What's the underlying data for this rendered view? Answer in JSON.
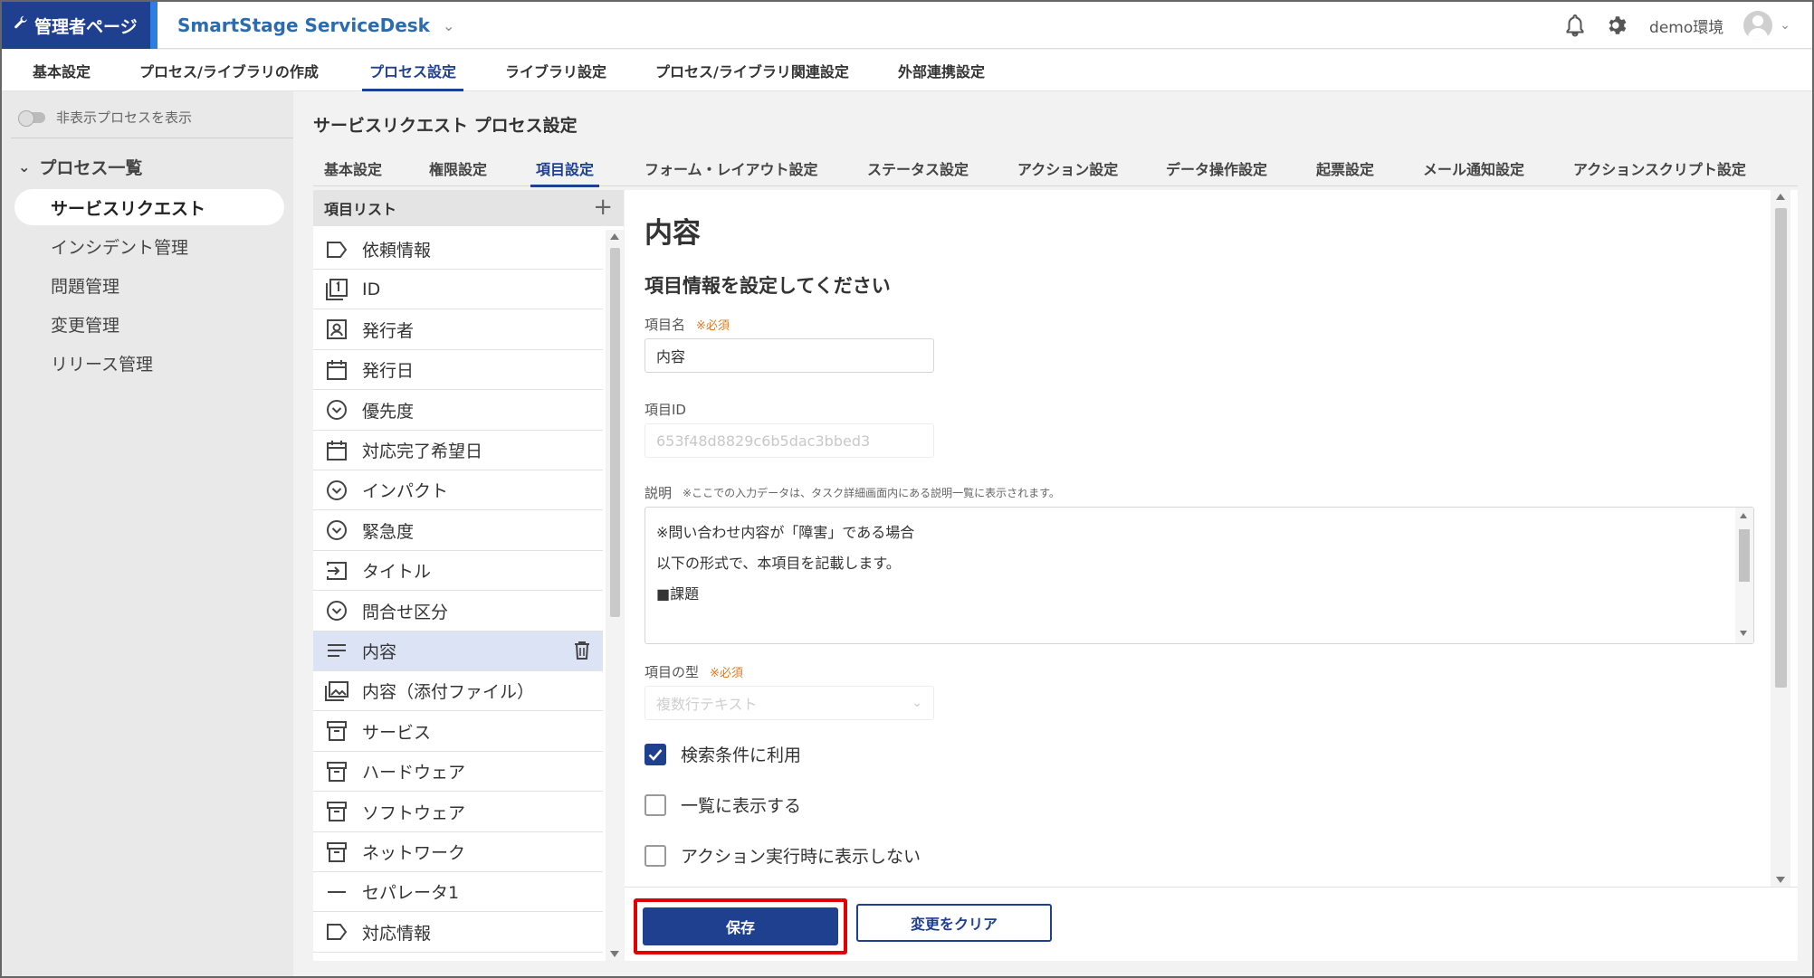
{
  "header": {
    "admin_label": "管理者ページ",
    "app_title": "SmartStage ServiceDesk",
    "environment": "demo環境"
  },
  "main_nav": {
    "items": [
      {
        "label": "基本設定",
        "active": false
      },
      {
        "label": "プロセス/ライブラリの作成",
        "active": false
      },
      {
        "label": "プロセス設定",
        "active": true
      },
      {
        "label": "ライブラリ設定",
        "active": false
      },
      {
        "label": "プロセス/ライブラリ関連設定",
        "active": false
      },
      {
        "label": "外部連携設定",
        "active": false
      }
    ]
  },
  "sidebar": {
    "toggle_label": "非表示プロセスを表示",
    "heading": "プロセス一覧",
    "items": [
      {
        "label": "サービスリクエスト",
        "active": true
      },
      {
        "label": "インシデント管理",
        "active": false
      },
      {
        "label": "問題管理",
        "active": false
      },
      {
        "label": "変更管理",
        "active": false
      },
      {
        "label": "リリース管理",
        "active": false
      }
    ]
  },
  "page_title": "サービスリクエスト プロセス設定",
  "sub_tabs": [
    {
      "label": "基本設定",
      "active": false
    },
    {
      "label": "権限設定",
      "active": false
    },
    {
      "label": "項目設定",
      "active": true
    },
    {
      "label": "フォーム・レイアウト設定",
      "active": false
    },
    {
      "label": "ステータス設定",
      "active": false
    },
    {
      "label": "アクション設定",
      "active": false
    },
    {
      "label": "データ操作設定",
      "active": false
    },
    {
      "label": "起票設定",
      "active": false
    },
    {
      "label": "メール通知設定",
      "active": false
    },
    {
      "label": "アクションスクリプト設定",
      "active": false
    }
  ],
  "item_list": {
    "header": "項目リスト",
    "items": [
      {
        "label": "依頼情報",
        "icon": "label-icon"
      },
      {
        "label": "ID",
        "icon": "id-icon"
      },
      {
        "label": "発行者",
        "icon": "user-box-icon"
      },
      {
        "label": "発行日",
        "icon": "calendar-icon"
      },
      {
        "label": "優先度",
        "icon": "dropdown-circle-icon"
      },
      {
        "label": "対応完了希望日",
        "icon": "calendar-icon"
      },
      {
        "label": "インパクト",
        "icon": "dropdown-circle-icon"
      },
      {
        "label": "緊急度",
        "icon": "dropdown-circle-icon"
      },
      {
        "label": "タイトル",
        "icon": "text-input-icon"
      },
      {
        "label": "問合せ区分",
        "icon": "dropdown-circle-icon"
      },
      {
        "label": "内容",
        "icon": "multiline-text-icon",
        "selected": true
      },
      {
        "label": "内容（添付ファイル）",
        "icon": "attachment-icon"
      },
      {
        "label": "サービス",
        "icon": "library-icon"
      },
      {
        "label": "ハードウェア",
        "icon": "library-icon"
      },
      {
        "label": "ソフトウェア",
        "icon": "library-icon"
      },
      {
        "label": "ネットワーク",
        "icon": "library-icon"
      },
      {
        "label": "セパレータ1",
        "icon": "separator-icon"
      },
      {
        "label": "対応情報",
        "icon": "label-icon"
      }
    ]
  },
  "detail": {
    "title": "内容",
    "subtitle": "項目情報を設定してください",
    "name_label": "項目名",
    "required_mark": "※必須",
    "name_value": "内容",
    "id_label": "項目ID",
    "id_value": "653f48d8829c6b5dac3bbed3",
    "desc_label": "説明",
    "desc_hint": "※ここでの入力データは、タスク詳細画面内にある説明一覧に表示されます。",
    "desc_lines": [
      "※問い合わせ内容が「障害」である場合",
      "以下の形式で、本項目を記載します。",
      "■課題"
    ],
    "type_label": "項目の型",
    "type_value": "複数行テキスト",
    "checkboxes": [
      {
        "label": "検索条件に利用",
        "checked": true
      },
      {
        "label": "一覧に表示する",
        "checked": false
      },
      {
        "label": "アクション実行時に表示しない",
        "checked": false
      }
    ]
  },
  "footer": {
    "save_label": "保存",
    "clear_label": "変更をクリア"
  },
  "colors": {
    "primary": "#1f3f8f",
    "highlight_border": "#e00000",
    "required": "#e07a1f"
  }
}
